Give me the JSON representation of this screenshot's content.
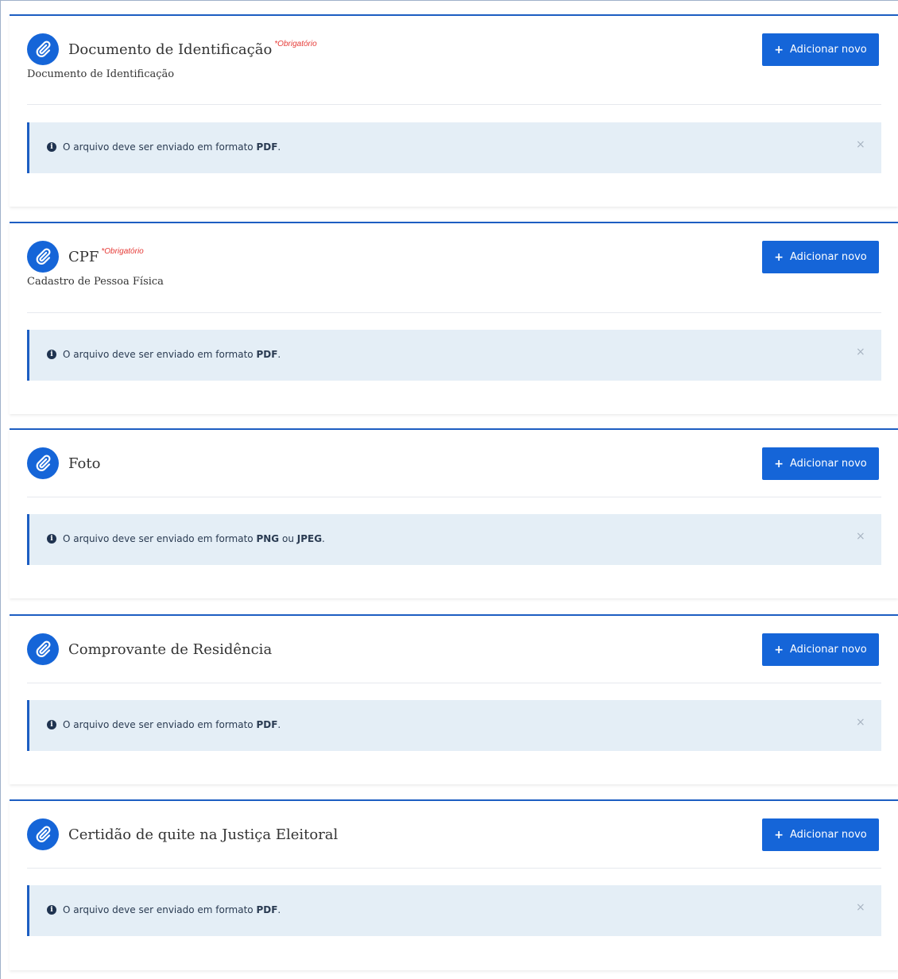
{
  "sections": [
    {
      "title": "Documento de Identificação",
      "required_label": "*Obrigatório",
      "subtitle": "Documento de Identificação",
      "add_button_label": "Adicionar novo",
      "alert": {
        "prefix": "O arquivo deve ser enviado em formato ",
        "formats": [
          "PDF"
        ],
        "joiner": "",
        "suffix": "."
      }
    },
    {
      "title": "CPF",
      "required_label": "*Obrigatório",
      "subtitle": "Cadastro de Pessoa Física",
      "add_button_label": "Adicionar novo",
      "alert": {
        "prefix": "O arquivo deve ser enviado em formato ",
        "formats": [
          "PDF"
        ],
        "joiner": "",
        "suffix": "."
      }
    },
    {
      "title": "Foto",
      "required_label": "",
      "subtitle": "",
      "add_button_label": "Adicionar novo",
      "alert": {
        "prefix": "O arquivo deve ser enviado em formato ",
        "formats": [
          "PNG",
          "JPEG"
        ],
        "joiner": " ou ",
        "suffix": "."
      }
    },
    {
      "title": "Comprovante de Residência",
      "required_label": "",
      "subtitle": "",
      "add_button_label": "Adicionar novo",
      "alert": {
        "prefix": "O arquivo deve ser enviado em formato ",
        "formats": [
          "PDF"
        ],
        "joiner": "",
        "suffix": "."
      }
    },
    {
      "title": "Certidão de quite na Justiça Eleitoral",
      "required_label": "",
      "subtitle": "",
      "add_button_label": "Adicionar novo",
      "alert": {
        "prefix": "O arquivo deve ser enviado em formato ",
        "formats": [
          "PDF"
        ],
        "joiner": "",
        "suffix": "."
      }
    }
  ],
  "icons": {
    "section": "paperclip-icon",
    "add": "plus-icon",
    "info": "info-icon",
    "close": "close-icon"
  },
  "close_glyph": "×",
  "info_glyph": "i",
  "plus_glyph": "+",
  "colors": {
    "accent": "#1565d8",
    "required": "#e53935",
    "alert_bg": "#e4eef6",
    "card_border": "#1d5ec2"
  }
}
